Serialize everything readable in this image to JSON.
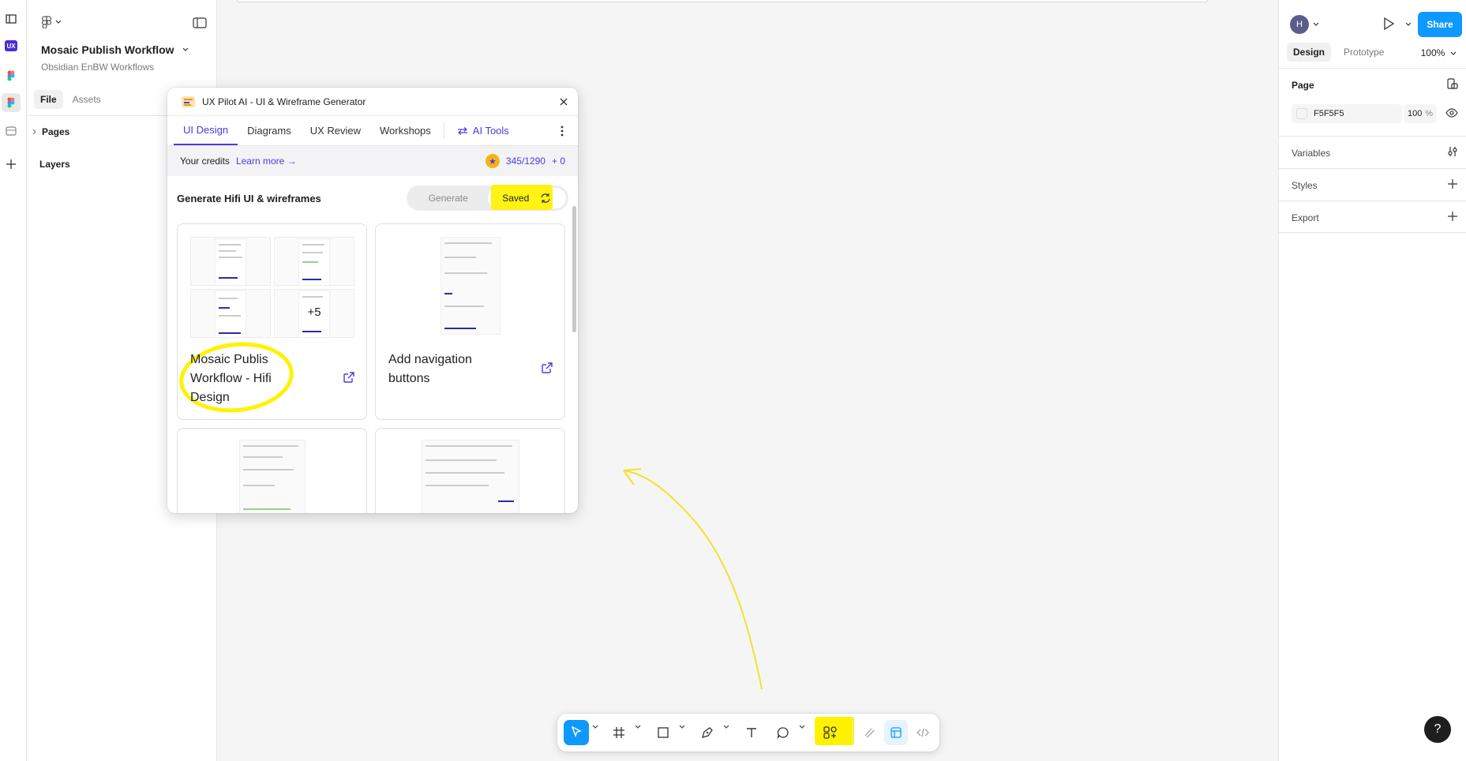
{
  "file": {
    "title": "Mosaic Publish Workflow",
    "subtitle": "Obsidian EnBW Workflows"
  },
  "left_panel": {
    "tabs": [
      "File",
      "Assets"
    ],
    "sections": {
      "pages": "Pages",
      "layers": "Layers"
    }
  },
  "plugin": {
    "title": "UX Pilot AI - UI & Wireframe Generator",
    "tabs": [
      "UI Design",
      "Diagrams",
      "UX Review",
      "Workshops"
    ],
    "ai_tools": "AI Tools",
    "credits_label": "Your credits",
    "learn_more": "Learn more →",
    "credits_value": "345/1290",
    "credits_extra": "+ 0",
    "generate_heading": "Generate Hifi UI & wireframes",
    "toggle": {
      "generate": "Generate",
      "saved": "Saved"
    },
    "cards": [
      {
        "label": "Mosaic Publis Workflow - Hifi Design",
        "more": "+5"
      },
      {
        "label": "Add navigation buttons"
      }
    ]
  },
  "right_panel": {
    "avatar_initial": "H",
    "share": "Share",
    "tabs": [
      "Design",
      "Prototype"
    ],
    "zoom": "100%",
    "page_label": "Page",
    "page_color": "F5F5F5",
    "page_opacity": "100",
    "page_opacity_unit": "%",
    "sections": {
      "variables": "Variables",
      "styles": "Styles",
      "export": "Export"
    }
  },
  "help": "?",
  "colors": {
    "accent": "#0d99ff",
    "plugin_accent": "#4b3ae0",
    "highlight": "#fff200"
  }
}
